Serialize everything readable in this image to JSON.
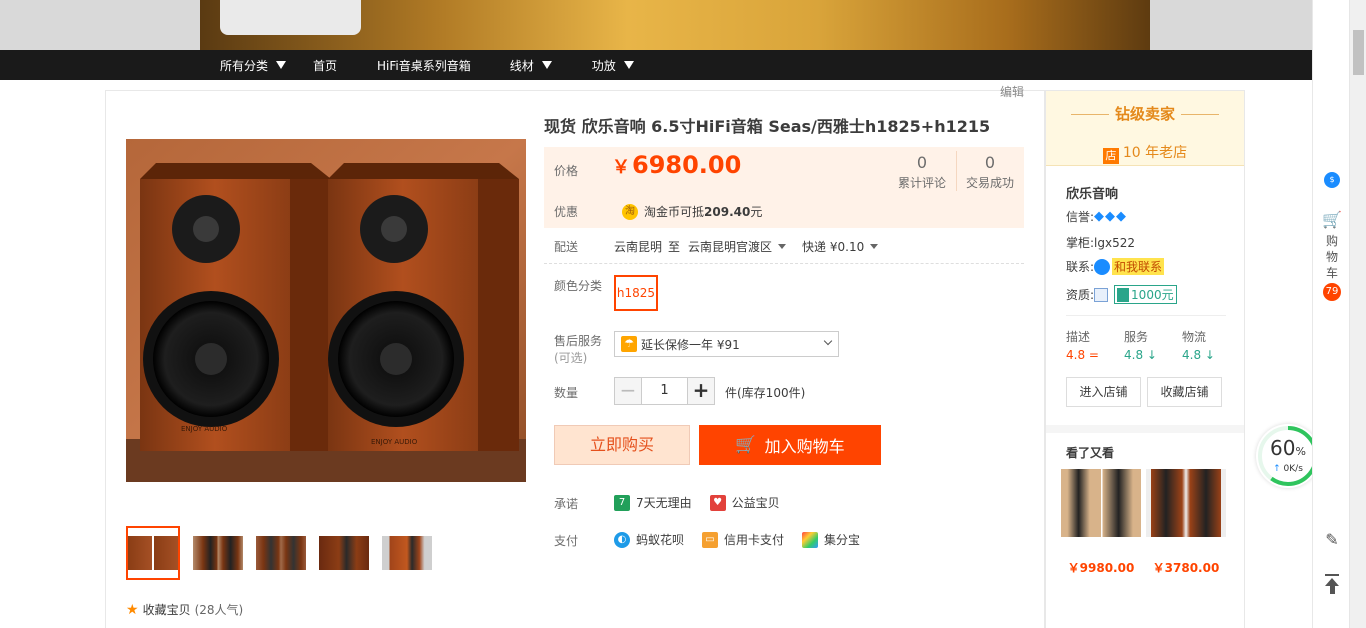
{
  "nav": {
    "items": [
      {
        "label": "所有分类",
        "caret": true
      },
      {
        "label": "首页",
        "caret": false
      },
      {
        "label": "HiFi音桌系列音箱",
        "caret": false
      },
      {
        "label": "线材",
        "caret": true
      },
      {
        "label": "功放",
        "caret": true
      }
    ]
  },
  "edit_label": "编辑",
  "product": {
    "title": "现货 欣乐音响 6.5寸HiFi音箱 Seas/西雅士h1825+h1215",
    "price_label": "价格",
    "currency": "￥",
    "price": "6980.00",
    "reviews_count": "0",
    "reviews_label": "累计评论",
    "sales_count": "0",
    "sales_label": "交易成功",
    "promo_label": "优惠",
    "promo_icon": "淘",
    "promo_text_prefix": "淘金币可抵",
    "promo_amount": "209.40",
    "promo_text_suffix": "元",
    "ship_label": "配送",
    "ship_from": "云南昆明",
    "ship_to_word": "至",
    "ship_to": "云南昆明官渡区",
    "ship_method": "快递 ¥0.10",
    "color_label": "颜色分类",
    "sku_selected": "h1825",
    "service_label": "售后服务",
    "service_optional": "(可选)",
    "service_selected": "延长保修一年 ¥91",
    "qty_label": "数量",
    "qty_value": "1",
    "qty_minus": "−",
    "qty_plus": "+",
    "qty_stock": "件(库存100件)",
    "buy_now": "立即购买",
    "add_cart": "加入购物车",
    "promise_label": "承诺",
    "promises": [
      "7天无理由",
      "公益宝贝"
    ],
    "pay_label": "支付",
    "payments": [
      "蚂蚁花呗",
      "信用卡支付",
      "集分宝"
    ],
    "favorite_label": "收藏宝贝",
    "favorite_popularity": "(28人气)",
    "image_alt_logo": "ENJOY AUDIO",
    "thumbnail_count": 5
  },
  "seller": {
    "rank": "钻级卖家",
    "age_badge": "店",
    "age": "10 年老店",
    "shop_name": "欣乐音响",
    "credit_label": "信誉:",
    "credit_diamonds": [
      "💎",
      "💎",
      "💎"
    ],
    "owner_label": "掌柜:",
    "owner": "lgx522",
    "contact_label": "联系:",
    "contact": "和我联系",
    "qual_label": "资质:",
    "deposit": "1000元",
    "dsr": [
      {
        "label": "描述",
        "value": "4.8 ="
      },
      {
        "label": "服务",
        "value": "4.8 ↓"
      },
      {
        "label": "物流",
        "value": "4.8 ↓"
      }
    ],
    "enter_shop": "进入店铺",
    "fav_shop": "收藏店铺",
    "seen_title": "看了又看",
    "recommendations": [
      {
        "price": "￥9980.00"
      },
      {
        "price": "￥3780.00"
      }
    ]
  },
  "toolbar": {
    "cart_label": "购物车",
    "cart_count": "79",
    "bubble_text": "$"
  },
  "speed_widget": {
    "percent": "60",
    "percent_sign": "%",
    "net_speed": "0K/s",
    "arrow": "↑"
  },
  "colors": {
    "accent": "#ff4400",
    "gold": "#e4891b",
    "green": "#2aa58a"
  }
}
